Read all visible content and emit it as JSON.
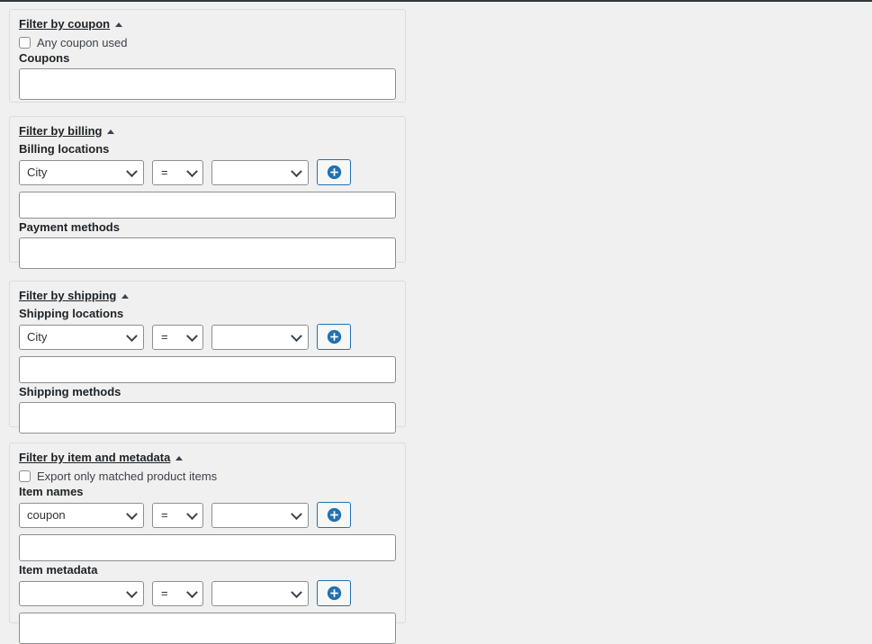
{
  "theme": {
    "page_background": "#f0f0f1",
    "panel_background": "#f0f0f1",
    "panel_border": "#dcdcde",
    "input_border": "#8c8f94",
    "accent": "#2271b1",
    "heading_color": "#1d2327",
    "text_color": "#3c434a",
    "admin_bar": "#32373c"
  },
  "panels": [
    {
      "id": "coupon",
      "title": "Filter by coupon",
      "caret_icon": "caret-up-icon",
      "checkbox": {
        "label": "Any coupon used",
        "checked": false
      },
      "fields": [
        {
          "label": "Coupons",
          "type": "text",
          "value": "",
          "placeholder": ""
        }
      ]
    },
    {
      "id": "billing",
      "title": "Filter by billing",
      "caret_icon": "caret-up-icon",
      "fields": [
        {
          "label": "Billing locations",
          "type": "filter-row",
          "key_select": {
            "value": "City",
            "placeholder": ""
          },
          "operator_select": {
            "value": "="
          },
          "value_select": {
            "value": "",
            "placeholder": ""
          },
          "add_button": {
            "icon": "plus-circle-icon",
            "label": ""
          },
          "text_value": "",
          "text_placeholder": ""
        },
        {
          "label": "Payment methods",
          "type": "text",
          "value": "",
          "placeholder": ""
        }
      ]
    },
    {
      "id": "shipping",
      "title": "Filter by shipping",
      "caret_icon": "caret-up-icon",
      "fields": [
        {
          "label": "Shipping locations",
          "type": "filter-row",
          "key_select": {
            "value": "City",
            "placeholder": ""
          },
          "operator_select": {
            "value": "="
          },
          "value_select": {
            "value": "",
            "placeholder": ""
          },
          "add_button": {
            "icon": "plus-circle-icon",
            "label": ""
          },
          "text_value": "",
          "text_placeholder": ""
        },
        {
          "label": "Shipping methods",
          "type": "text",
          "value": "",
          "placeholder": ""
        }
      ]
    },
    {
      "id": "item-and-metadata",
      "title": "Filter by item and metadata",
      "caret_icon": "caret-up-icon",
      "checkbox": {
        "label": "Export only matched product items",
        "checked": false
      },
      "fields": [
        {
          "label": "Item names",
          "type": "filter-row",
          "key_select": {
            "value": "coupon",
            "placeholder": ""
          },
          "operator_select": {
            "value": "="
          },
          "value_select": {
            "value": "",
            "placeholder": ""
          },
          "add_button": {
            "icon": "plus-circle-icon",
            "label": ""
          },
          "text_value": "",
          "text_placeholder": ""
        },
        {
          "label": "Item metadata",
          "type": "filter-row",
          "key_select": {
            "value": "",
            "placeholder": ""
          },
          "operator_select": {
            "value": "="
          },
          "value_select": {
            "value": "",
            "placeholder": ""
          },
          "add_button": {
            "icon": "plus-circle-icon",
            "label": ""
          },
          "text_value": "",
          "text_placeholder": ""
        }
      ]
    }
  ]
}
